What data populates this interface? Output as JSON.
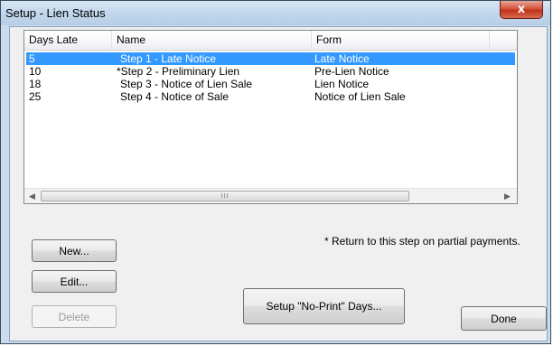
{
  "window": {
    "title": "Setup - Lien Status",
    "close_glyph": "x"
  },
  "list": {
    "columns": [
      "Days Late",
      "Name",
      "Form"
    ],
    "rows": [
      {
        "days": "5",
        "name": "Step 1 - Late Notice",
        "form": "Late Notice",
        "selected": true
      },
      {
        "days": "10",
        "name": "*Step 2 - Preliminary Lien",
        "form": "Pre-Lien Notice",
        "selected": false
      },
      {
        "days": "18",
        "name": "Step 3 - Notice of Lien Sale",
        "form": "Lien Notice",
        "selected": false
      },
      {
        "days": "25",
        "name": "Step 4 - Notice of Sale",
        "form": "Notice of Lien Sale",
        "selected": false
      }
    ],
    "scroll_thumb_glyph": "III",
    "scroll_left_glyph": "◀",
    "scroll_right_glyph": "▶"
  },
  "note": "* Return to this step on partial payments.",
  "buttons": {
    "new": "New...",
    "edit": "Edit...",
    "delete": "Delete",
    "no_print": "Setup \"No-Print\" Days...",
    "done": "Done"
  },
  "colors": {
    "selection": "#3399ff",
    "close_button": "#c8432b"
  }
}
